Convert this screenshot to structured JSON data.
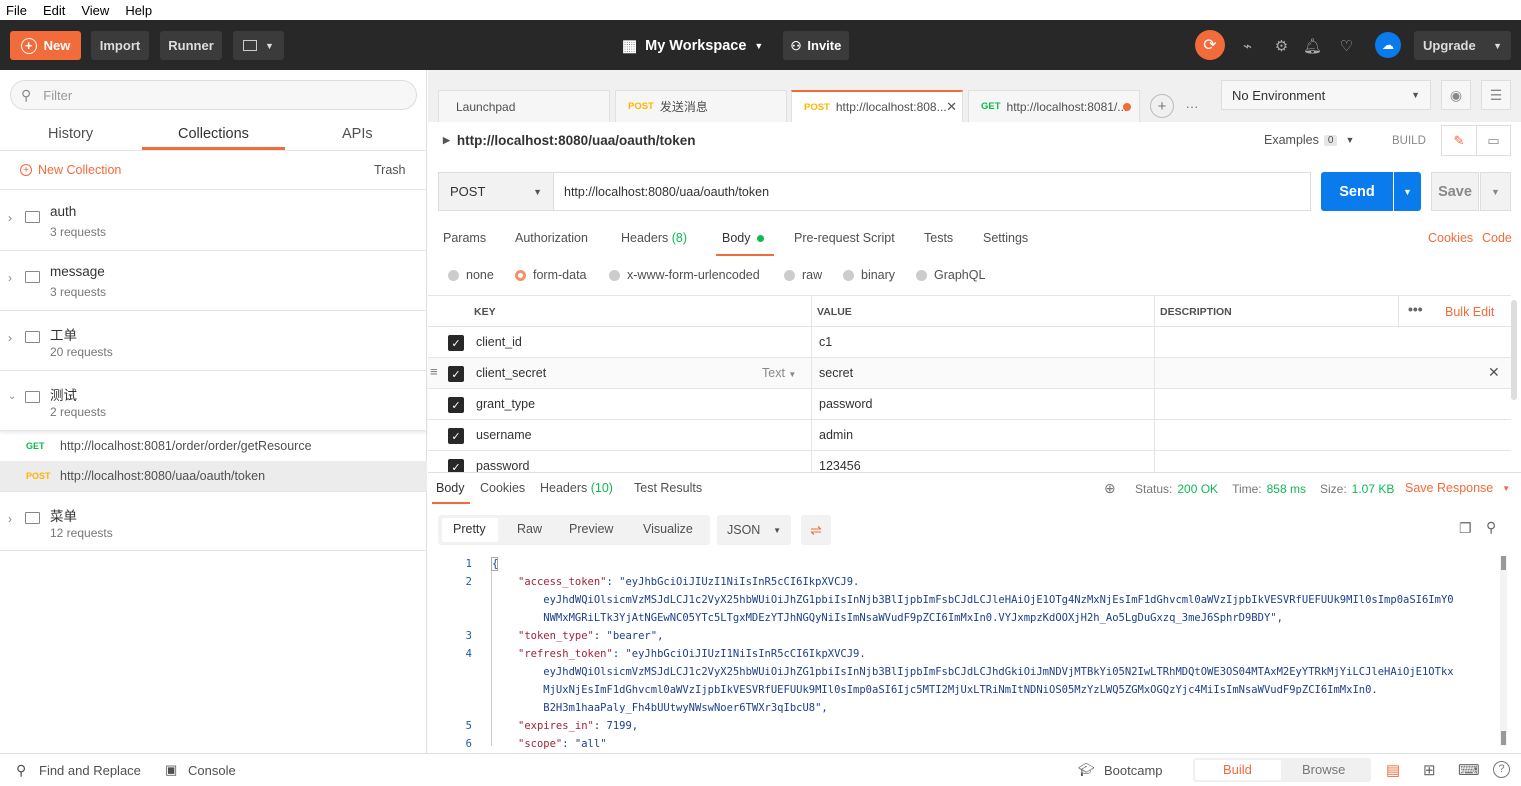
{
  "menubar": [
    "File",
    "Edit",
    "View",
    "Help"
  ],
  "header": {
    "new": "New",
    "import": "Import",
    "runner": "Runner",
    "workspace": "My Workspace",
    "invite": "Invite",
    "upgrade": "Upgrade"
  },
  "sidebar": {
    "search_placeholder": "Filter",
    "tabs": [
      "History",
      "Collections",
      "APIs"
    ],
    "new_collection": "New Collection",
    "trash": "Trash",
    "collections": [
      {
        "name": "auth",
        "count": "3 requests"
      },
      {
        "name": "message",
        "count": "3 requests"
      },
      {
        "name": "工单",
        "count": "20 requests"
      },
      {
        "name": "测试",
        "count": "2 requests"
      },
      {
        "name": "菜单",
        "count": "12 requests"
      }
    ],
    "requests": [
      {
        "method": "GET",
        "url": "http://localhost:8081/order/order/getResource"
      },
      {
        "method": "POST",
        "url": "http://localhost:8080/uaa/oauth/token"
      }
    ]
  },
  "tabs": [
    {
      "method": "",
      "label": "Launchpad"
    },
    {
      "method": "POST",
      "label": "发送消息"
    },
    {
      "method": "POST",
      "label": "http://localhost:808..."
    },
    {
      "method": "GET",
      "label": "http://localhost:8081/..."
    }
  ],
  "environment": "No Environment",
  "request": {
    "title": "http://localhost:8080/uaa/oauth/token",
    "examples": "Examples",
    "examples_count": "0",
    "build": "BUILD",
    "method": "POST",
    "url": "http://localhost:8080/uaa/oauth/token",
    "send": "Send",
    "save": "Save",
    "subtabs": [
      "Params",
      "Authorization",
      "Headers",
      "Body",
      "Pre-request Script",
      "Tests",
      "Settings"
    ],
    "headers_count": "(8)",
    "cookies": "Cookies",
    "code": "Code",
    "body_types": [
      "none",
      "form-data",
      "x-www-form-urlencoded",
      "raw",
      "binary",
      "GraphQL"
    ],
    "columns": [
      "KEY",
      "VALUE",
      "DESCRIPTION"
    ],
    "bulk_edit": "Bulk Edit",
    "type_text": "Text",
    "rows": [
      {
        "key": "client_id",
        "value": "c1"
      },
      {
        "key": "client_secret",
        "value": "secret"
      },
      {
        "key": "grant_type",
        "value": "password"
      },
      {
        "key": "username",
        "value": "admin"
      },
      {
        "key": "password",
        "value": "123456"
      }
    ]
  },
  "response": {
    "tabs": [
      "Body",
      "Cookies",
      "Headers",
      "Test Results"
    ],
    "headers_count": "(10)",
    "status_label": "Status:",
    "status": "200 OK",
    "time_label": "Time:",
    "time": "858 ms",
    "size_label": "Size:",
    "size": "1.07 KB",
    "save_response": "Save Response",
    "view_tabs": [
      "Pretty",
      "Raw",
      "Preview",
      "Visualize"
    ],
    "format": "JSON",
    "lines": [
      {
        "n": "1",
        "t": "{"
      },
      {
        "n": "2",
        "k": "\"access_token\"",
        "v": ": \"eyJhbGciOiJIUzI1NiIsInR5cCI6IkpXVCJ9."
      },
      {
        "n": "",
        "v": "    eyJhdWQiOlsicmVzMSJdLCJ1c2VyX25hbWUiOiJhZG1pbiIsInNjb3BlIjpbImFsbCJdLCJleHAiOjE1OTg4NzMxNjEsImF1dGhvcml0aWVzIjpbIkVESVRfUEFUUk9MIl0sImp0aSI6ImY0"
      },
      {
        "n": "",
        "v": "    NWMxMGRiLTk3YjAtNGEwNC05YTc5LTgxMDEzYTJhNGQyNiIsImNsaWVudF9pZCI6ImMxIn0.VYJxmpzKdOOXjH2h_Ao5LgDuGxzq_3meJ6SphrD9BDY\","
      },
      {
        "n": "3",
        "k": "\"token_type\"",
        "v": ": \"bearer\","
      },
      {
        "n": "4",
        "k": "\"refresh_token\"",
        "v": ": \"eyJhbGciOiJIUzI1NiIsInR5cCI6IkpXVCJ9."
      },
      {
        "n": "",
        "v": "    eyJhdWQiOlsicmVzMSJdLCJ1c2VyX25hbWUiOiJhZG1pbiIsInNjb3BlIjpbImFsbCJdLCJhdGkiOiJmNDVjMTBkYi05N2IwLTRhMDQtOWE3OS04MTAxM2EyYTRkMjYiLCJleHAiOjE1OTkx"
      },
      {
        "n": "",
        "v": "    MjUxNjEsImF1dGhvcml0aWVzIjpbIkVESVRfUEFUUk9MIl0sImp0aSI6Ijc5MTI2MjUxLTRiNmItNDNiOS05MzYzLWQ5ZGMxOGQzYjc4MiIsImNsaWVudF9pZCI6ImMxIn0."
      },
      {
        "n": "",
        "v": "    B2H3m1haaPaly_Fh4bUUtwyNWswNoer6TWXr3qIbcU8\","
      },
      {
        "n": "5",
        "k": "\"expires_in\"",
        "v": ": 7199,"
      },
      {
        "n": "6",
        "k": "\"scope\"",
        "v": ": \"all\""
      }
    ]
  },
  "footer": {
    "find_replace": "Find and Replace",
    "console": "Console",
    "bootcamp": "Bootcamp",
    "build": "Build",
    "browse": "Browse"
  },
  "colors": {
    "accent": "#f26b3a",
    "send": "#097bed",
    "get": "#0cbb52",
    "post": "#ffb400",
    "header_bg": "#282828"
  }
}
